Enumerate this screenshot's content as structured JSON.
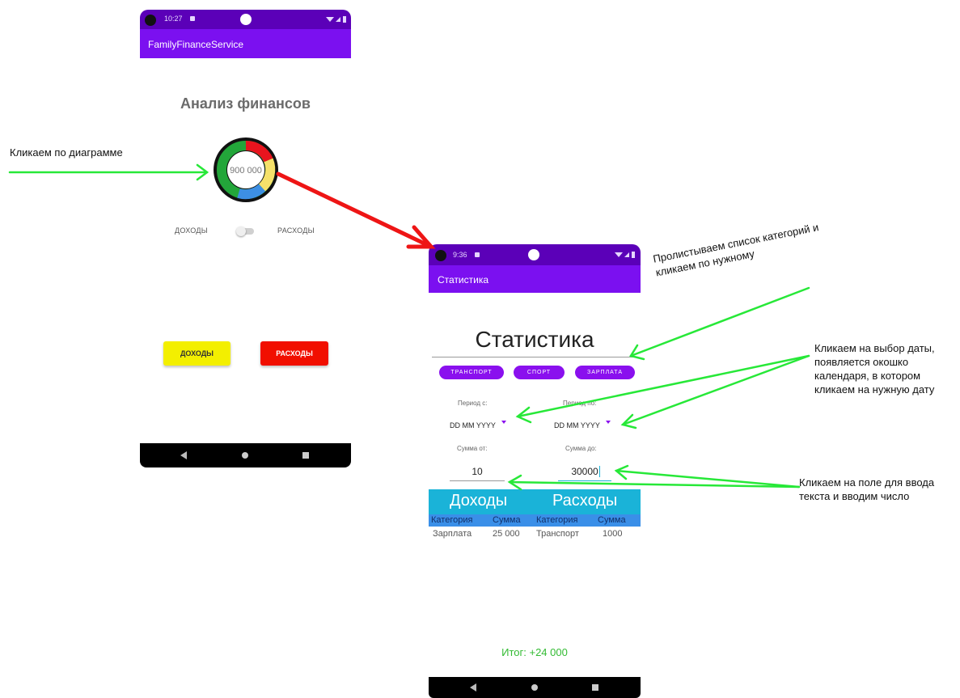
{
  "phone1": {
    "status_time": "10:27",
    "app_title": "FamilyFinanceService",
    "page_title": "Анализ финансов",
    "donut_value": "900 000",
    "donut_colors": [
      "#e8141e",
      "#f5e16a",
      "#3d8fe3",
      "#23a63a"
    ],
    "toggle_left": "ДОХОДЫ",
    "toggle_right": "РАСХОДЫ",
    "btn_income": "ДОХОДЫ",
    "btn_expense": "РАСХОДЫ"
  },
  "phone2": {
    "status_time": "9:36",
    "app_title": "Статистика",
    "page_title": "Статистика",
    "chips": [
      "ТРАНСПОРТ",
      "СПОРТ",
      "ЗАРПЛАТА"
    ],
    "period_from_label": "Период с:",
    "period_to_label": "Период по:",
    "date_placeholder_from": "DD MM YYYY",
    "date_placeholder_to": "DD MM YYYY",
    "sum_from_label": "Сумма от:",
    "sum_to_label": "Сумма до:",
    "sum_from_value": "10",
    "sum_to_value": "30000",
    "table": {
      "income_title": "Доходы",
      "expense_title": "Расходы",
      "col_category": "Категория",
      "col_sum": "Сумма",
      "income_rows": [
        {
          "category": "Зарплата",
          "sum": "25 000"
        }
      ],
      "expense_rows": [
        {
          "category": "Транспорт",
          "sum": "1000"
        }
      ]
    },
    "total": "Итог: +24 000"
  },
  "annotations": {
    "click_chart": "Кликаем по диаграмме",
    "scroll_categories": "Пролистываем список категорий и кликаем по нужному",
    "date_pick": "Кликаем на выбор даты, появляется окошко календаря, в котором кликаем на нужную дату",
    "input_field": "Кликаем на поле для ввода текста и вводим число"
  },
  "colors": {
    "purple_dark": "#5b00b8",
    "purple": "#7b10f0",
    "chip": "#8a10ee",
    "arrow_green": "#27e838",
    "arrow_red": "#ee1515",
    "income_btn": "#f3ef00",
    "expense_btn": "#f10f00",
    "total_green": "#33bb33"
  }
}
